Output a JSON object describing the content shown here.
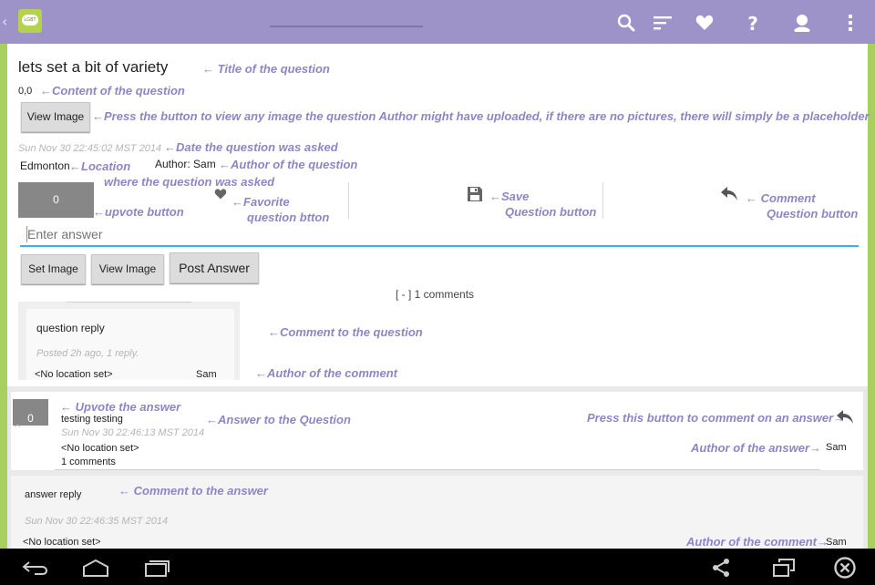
{
  "action_bar": {
    "logo_text": "LGBT",
    "icons": [
      "search-icon",
      "sort-icon",
      "favorite-icon",
      "help-icon",
      "profile-icon",
      "overflow-menu-icon"
    ]
  },
  "question": {
    "title": "lets set a bit of variety",
    "content": "0,0",
    "view_image_label": "View Image",
    "date": "Sun Nov 30 22:45:02 MST 2014",
    "location": "Edmonton",
    "author": "Author: Sam",
    "upvotes": "0"
  },
  "answer_input": {
    "placeholder": "Enter answer"
  },
  "buttons": {
    "set_image": "Set Image",
    "view_image": "View Image",
    "post_answer": "Post Answer"
  },
  "comments_toggle": "[ - ] 1 comments",
  "question_comment": {
    "text": "question reply",
    "meta": "Posted 2h ago, 1 reply.",
    "location": "<No location set>",
    "author": "Sam"
  },
  "answer": {
    "upvotes": "0",
    "text": "testing testing",
    "date": "Sun Nov 30 22:46:13 MST 2014",
    "location": "<No location set>",
    "comments": "1 comments",
    "author": "Sam"
  },
  "answer_comment": {
    "text": "answer reply",
    "date": "Sun Nov 30 22:46:35 MST 2014",
    "location": "<No location set>",
    "author": "Sam"
  },
  "annotations": {
    "title": "← Title of the question",
    "content": "←Content of the question",
    "view_image": "←Press the button to view any image the question Author might have uploaded, if there are no pictures, there will simply be a placeholder",
    "date": "←Date the question was asked",
    "location": "←Location",
    "location_2": "where the question was asked",
    "author": "←Author of the question",
    "upvote": "←upvote button",
    "favorite_1": "←Favorite",
    "favorite_2": "question btton",
    "save_1": "←Save",
    "save_2": "Question button",
    "comment_1": "← Comment",
    "comment_2": "Question button",
    "comment_to_question": "←Comment to the question",
    "author_of_comment": "←Author of the comment",
    "upvote_answer": "← Upvote the answer",
    "answer_to_question": "←Answer to the Question",
    "press_comment_answer": "Press this button to comment on an answer→",
    "author_of_answer": "Author of the answer→",
    "comment_to_answer": "← Comment to the answer",
    "author_of_answer_comment": "Author of the comment→"
  },
  "colors": {
    "action_bar": "#9d93c8",
    "accent_green": "#a9cf5e",
    "annotation": "#8e86c4",
    "input_underline": "#33b5e5"
  }
}
